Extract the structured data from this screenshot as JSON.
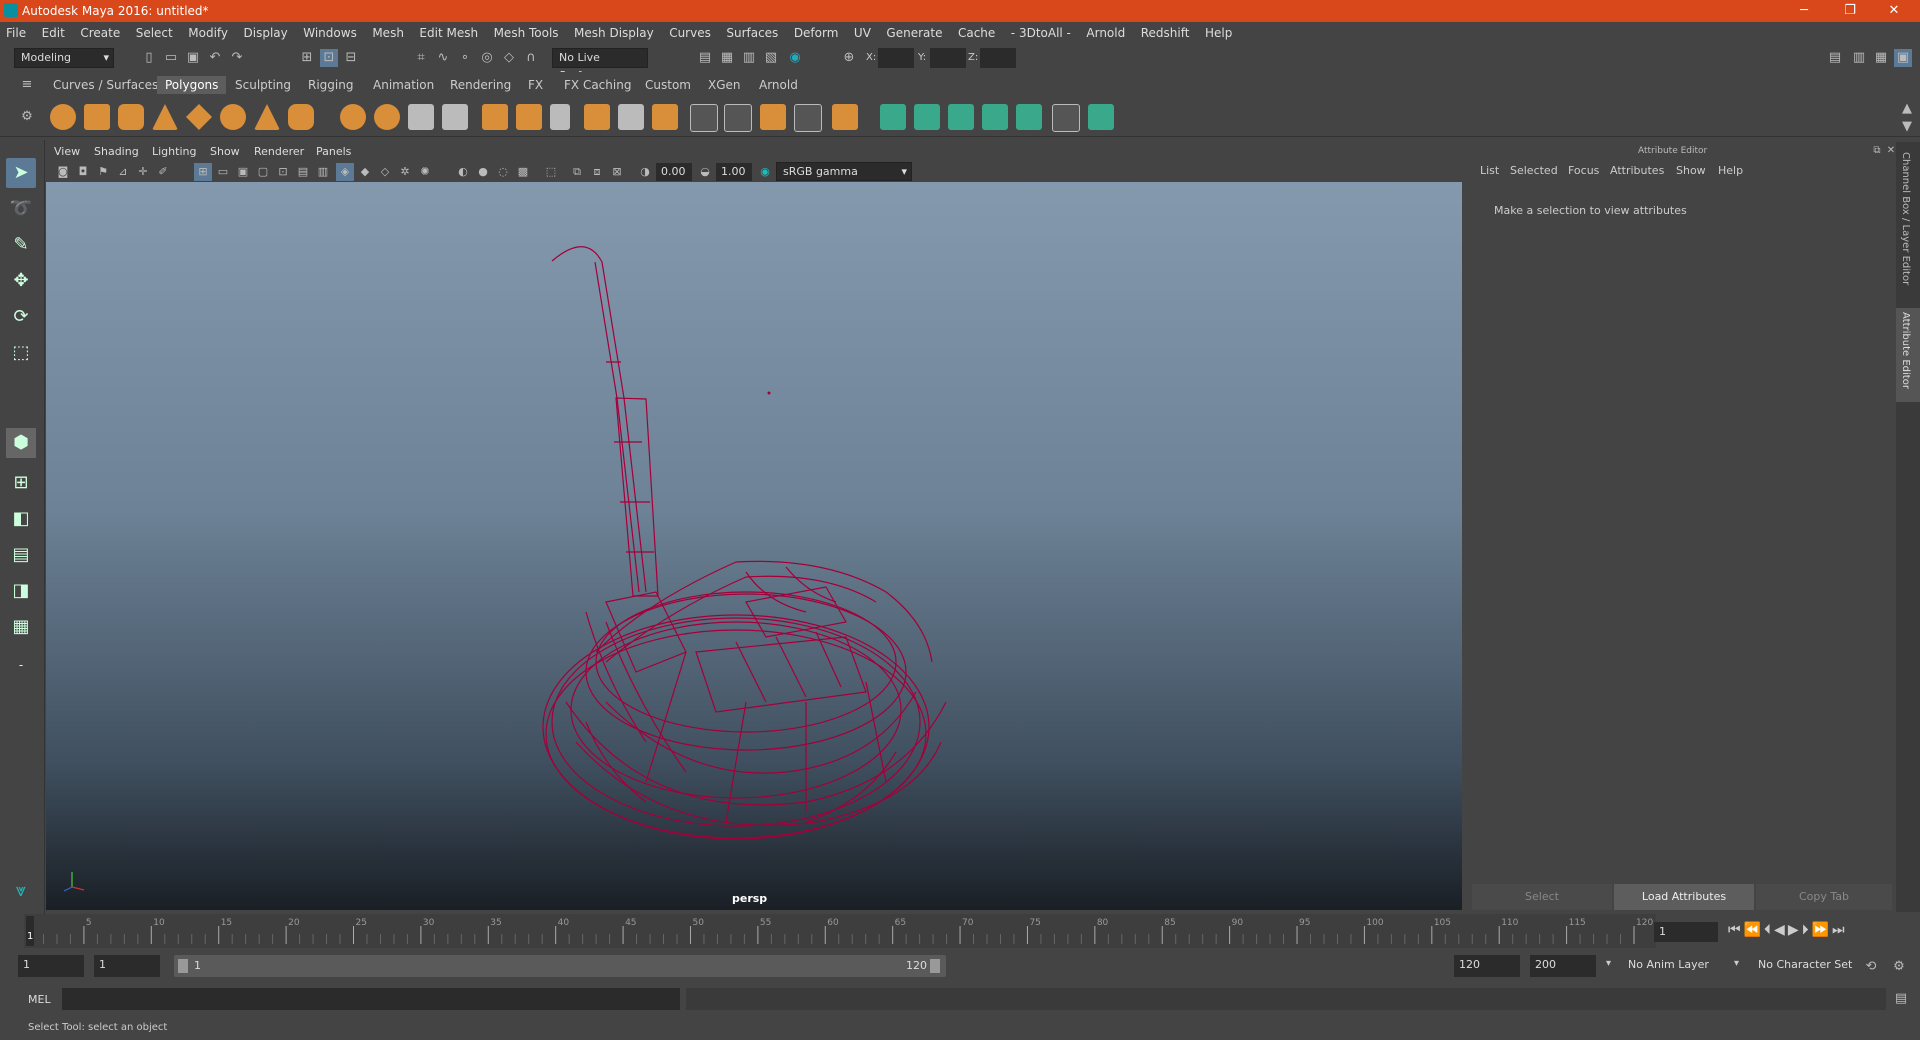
{
  "window": {
    "title": "Autodesk Maya 2016: untitled*",
    "minimize": "─",
    "restore": "❐",
    "close": "✕"
  },
  "menubar": [
    "File",
    "Edit",
    "Create",
    "Select",
    "Modify",
    "Display",
    "Windows",
    "Mesh",
    "Edit Mesh",
    "Mesh Tools",
    "Mesh Display",
    "Curves",
    "Surfaces",
    "Deform",
    "UV",
    "Generate",
    "Cache",
    "- 3DtoAll -",
    "Arnold",
    "Redshift",
    "Help"
  ],
  "statusline": {
    "mode": "Modeling",
    "live_surface": "No Live Surface",
    "x_label": "X:",
    "y_label": "Y:",
    "z_label": "Z:"
  },
  "shelf_tabs": [
    "Curves / Surfaces",
    "Polygons",
    "Sculpting",
    "Rigging",
    "Animation",
    "Rendering",
    "FX",
    "FX Caching",
    "Custom",
    "XGen",
    "Arnold"
  ],
  "shelf_active": "Polygons",
  "viewport": {
    "menu": [
      "View",
      "Shading",
      "Lighting",
      "Show",
      "Renderer",
      "Panels"
    ],
    "exposure": "0.00",
    "gamma": "1.00",
    "colorspace": "sRGB gamma",
    "camera_label": "persp",
    "wire_color": "#a3003a"
  },
  "attribute_editor": {
    "title": "Attribute Editor",
    "menu": [
      "List",
      "Selected",
      "Focus",
      "Attributes",
      "Show",
      "Help"
    ],
    "message": "Make a selection to view attributes",
    "buttons": {
      "select": "Select",
      "load": "Load Attributes",
      "copy": "Copy Tab"
    }
  },
  "side_tabs": {
    "channel_box": "Channel Box / Layer Editor",
    "attribute_editor": "Attribute Editor"
  },
  "timeline": {
    "ticks": [
      5,
      10,
      15,
      20,
      25,
      30,
      35,
      40,
      45,
      50,
      55,
      60,
      65,
      70,
      75,
      80,
      85,
      90,
      95,
      100,
      105,
      110,
      115,
      120
    ],
    "current_label": "1",
    "current_frame": "1"
  },
  "range": {
    "start": "1",
    "playback_start": "1",
    "slider_start": "1",
    "slider_end": "120",
    "playback_end": "120",
    "end": "200",
    "anim_layer": "No Anim Layer",
    "character_set": "No Character Set"
  },
  "command": {
    "label": "MEL"
  },
  "help_line": "Select Tool: select an object",
  "colors": {
    "title_bar": "#d9481a",
    "shelf_orange": "#d98e3a",
    "shelf_green": "#3aa88a",
    "select_blue": "#5c7a96"
  }
}
